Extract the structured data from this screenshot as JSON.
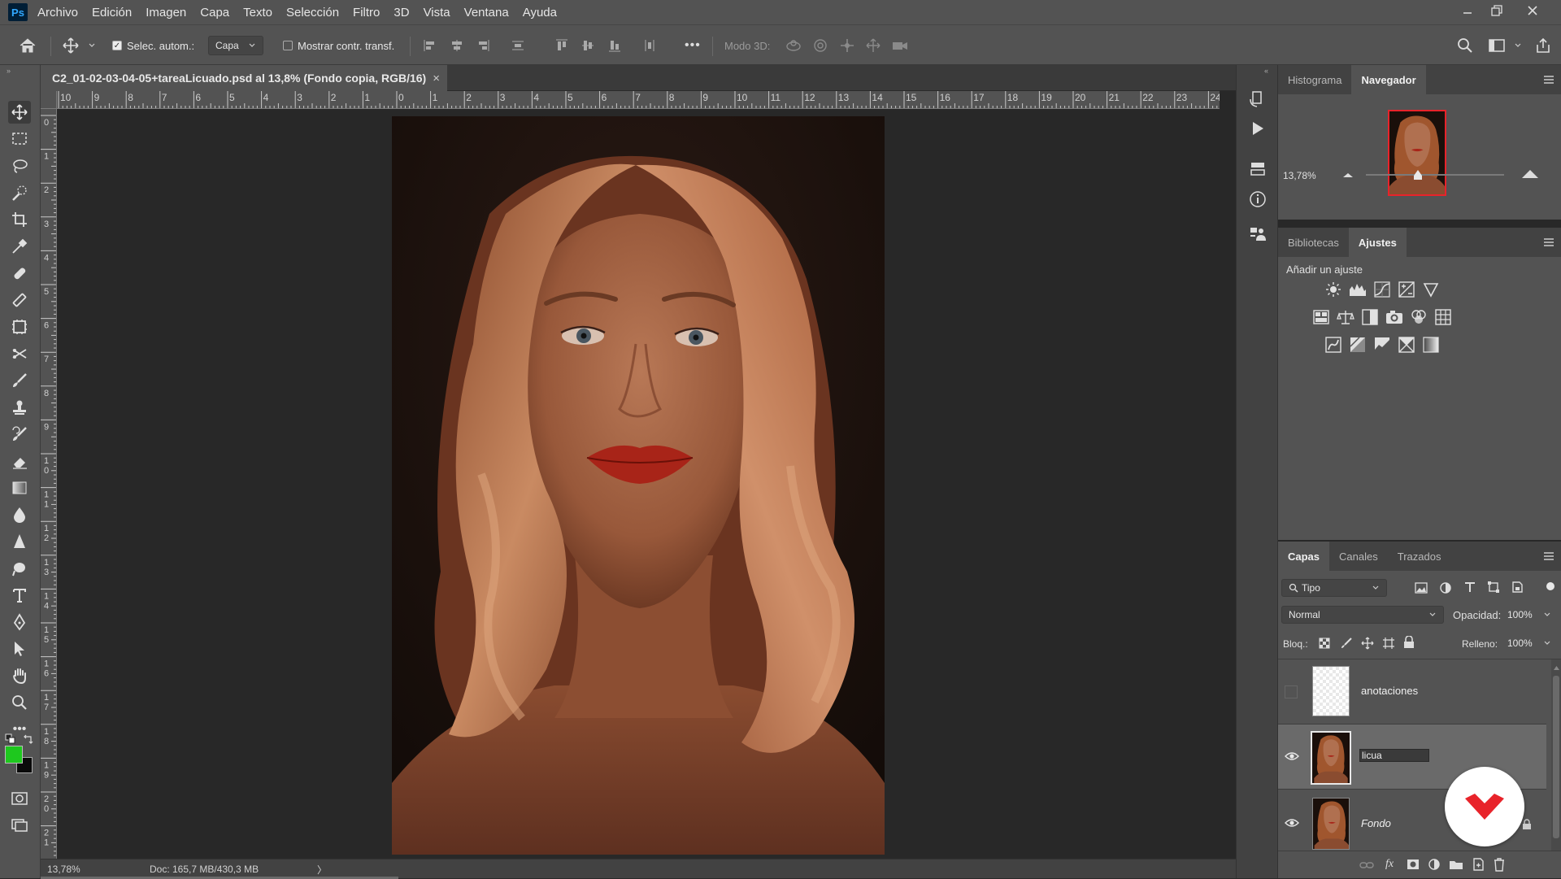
{
  "app": {
    "logo_text": "Ps"
  },
  "menu": [
    "Archivo",
    "Edición",
    "Imagen",
    "Capa",
    "Texto",
    "Selección",
    "Filtro",
    "3D",
    "Vista",
    "Ventana",
    "Ayuda"
  ],
  "options_bar": {
    "auto_select_label": "Selec. autom.:",
    "auto_select_checked": true,
    "auto_select_target": "Capa",
    "transform_label": "Mostrar contr. transf.",
    "transform_checked": false,
    "more_label": "•••",
    "mode3d_label": "Modo 3D:"
  },
  "document": {
    "tab_title": "C2_01-02-03-04-05+tareaLicuado.psd al 13,8% (Fondo copia, RGB/16)",
    "close": "×"
  },
  "rulers": {
    "top": [
      "10",
      "9",
      "8",
      "7",
      "6",
      "5",
      "4",
      "3",
      "2",
      "1",
      "0",
      "1",
      "2",
      "3",
      "4",
      "5",
      "6",
      "7",
      "8",
      "9",
      "10",
      "11",
      "12",
      "13",
      "14",
      "15",
      "16",
      "17",
      "18",
      "19",
      "20",
      "21",
      "22",
      "23",
      "24"
    ],
    "left": [
      "0",
      "1",
      "2",
      "3",
      "4",
      "5",
      "6",
      "7",
      "8",
      "9",
      "1 0",
      "1 1",
      "1 2",
      "1 3",
      "1 4",
      "1 5",
      "1 6",
      "1 7",
      "1 8",
      "1 9",
      "2 0",
      "2 1"
    ]
  },
  "status": {
    "zoom": "13,78%",
    "doc": "Doc: 165,7 MB/430,3 MB",
    "arrow": "〉"
  },
  "navigator": {
    "tabs": [
      "Histograma",
      "Navegador"
    ],
    "active_tab": "Navegador",
    "zoom": "13,78%"
  },
  "adjustments": {
    "tabs": [
      "Bibliotecas",
      "Ajustes"
    ],
    "active_tab": "Ajustes",
    "heading": "Añadir un ajuste"
  },
  "layers": {
    "tabs": [
      "Capas",
      "Canales",
      "Trazados"
    ],
    "active_tab": "Capas",
    "filter_label": "Tipo",
    "blend_mode": "Normal",
    "opacity_label": "Opacidad:",
    "opacity_value": "100%",
    "lock_label": "Bloq.:",
    "fill_label": "Relleno:",
    "fill_value": "100%",
    "items": [
      {
        "name": "anotaciones",
        "visible": false,
        "selected": false
      },
      {
        "name": "licua",
        "visible": true,
        "selected": true,
        "editing": true
      },
      {
        "name": "Fondo",
        "visible": true,
        "selected": false
      }
    ]
  },
  "colors": {
    "foreground": "#1ec81e",
    "background": "#0a0a0a",
    "accent": "#e8232a"
  }
}
